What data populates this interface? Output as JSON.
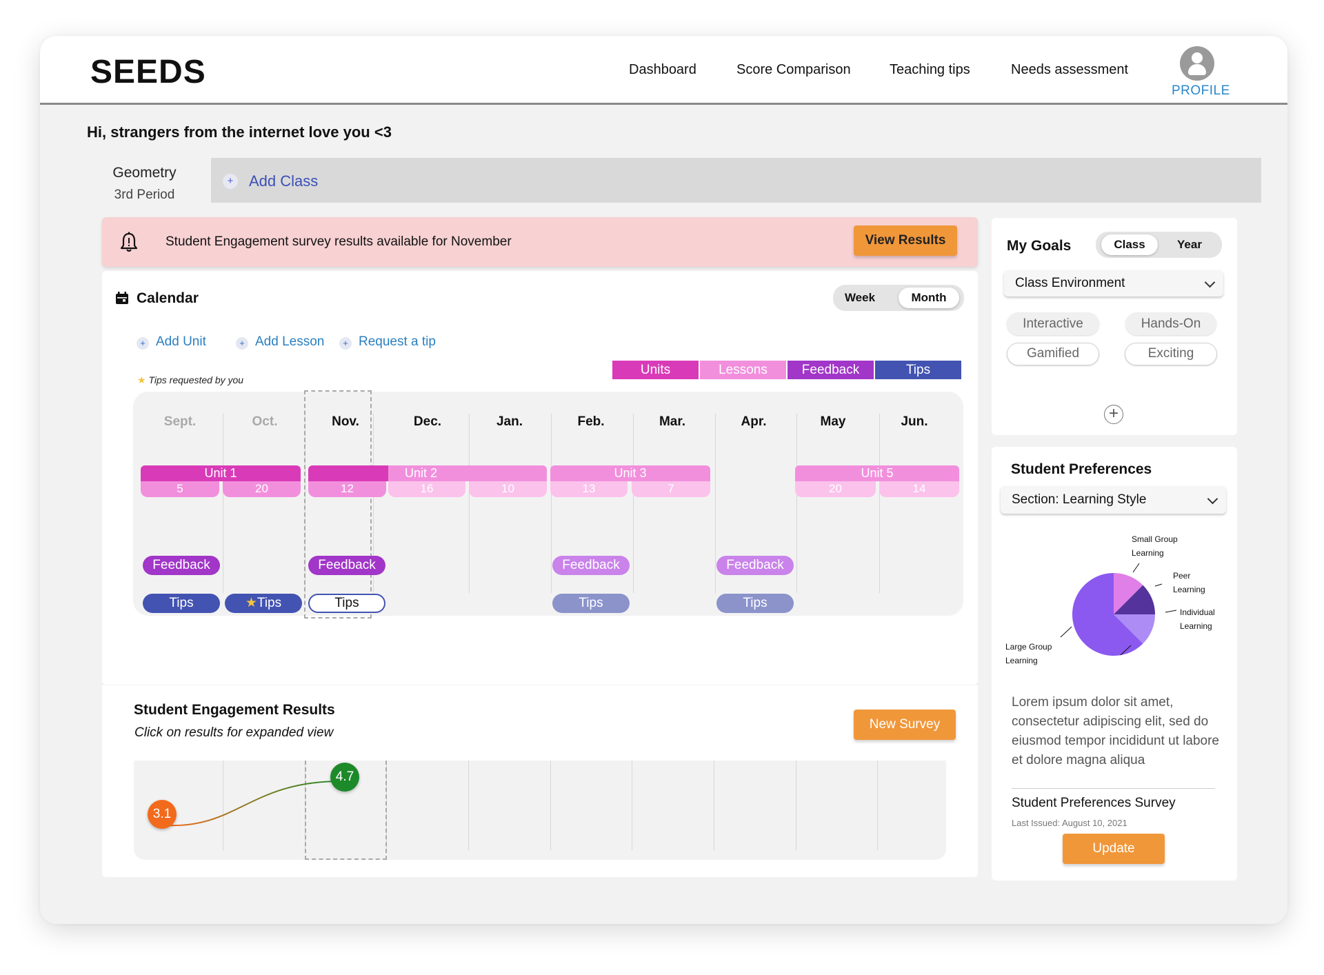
{
  "header": {
    "logo": "SEEDS",
    "nav": [
      "Dashboard",
      "Score Comparison",
      "Teaching tips",
      "Needs assessment"
    ],
    "profile_label": "PROFILE"
  },
  "greeting": "Hi, strangers from the internet love you <3",
  "class_tabs": {
    "active": {
      "name": "Geometry",
      "period": "3rd Period"
    },
    "add_class": "Add Class",
    "add_icon": "+"
  },
  "banner": {
    "text": "Student Engagement survey results available for November",
    "button": "View Results"
  },
  "calendar": {
    "title": "Calendar",
    "view_toggle": [
      "Week",
      "Month"
    ],
    "active_view": "Month",
    "actions": [
      "Add Unit",
      "Add Lesson",
      "Request a tip"
    ],
    "plus_icon": "+",
    "legend": [
      {
        "label": "Units",
        "color": "#d93bb8"
      },
      {
        "label": "Lessons",
        "color": "#f28fdd"
      },
      {
        "label": "Feedback",
        "color": "#a136c8"
      },
      {
        "label": "Tips",
        "color": "#4353b2"
      }
    ],
    "tips_note": "Tips requested by you",
    "star_icon": "★",
    "months": [
      "Sept.",
      "Oct.",
      "Nov.",
      "Dec.",
      "Jan.",
      "Feb.",
      "Mar.",
      "Apr.",
      "May",
      "Jun."
    ],
    "current_month": "Nov.",
    "units": [
      "Unit 1",
      "Unit 2",
      "Unit 3",
      "Unit 5"
    ],
    "lesson_days": [
      "5",
      "20",
      "12",
      "16",
      "10",
      "13",
      "7",
      "20",
      "14"
    ],
    "feedback_label": "Feedback",
    "tips_label": "Tips"
  },
  "engagement": {
    "title": "Student Engagement Results",
    "subtitle": "Click on results for expanded view",
    "button": "New Survey",
    "scores": [
      "3.1",
      "4.7"
    ]
  },
  "goals": {
    "title": "My Goals",
    "toggle": [
      "Class",
      "Year"
    ],
    "active_toggle": "Class",
    "dropdown": "Class Environment",
    "chips": [
      "Interactive",
      "Hands-On",
      "Gamified",
      "Exciting"
    ],
    "add_icon": "+"
  },
  "preferences": {
    "title": "Student Preferences",
    "dropdown": "Section: Learning Style",
    "pie": [
      {
        "label": "Small Group Learning",
        "line1": "Small Group",
        "line2": "Learning",
        "value": 12.5,
        "color": "#e07fe8"
      },
      {
        "label": "Peer Learning",
        "line1": "Peer",
        "line2": "Learning",
        "value": 12.5,
        "color": "#54339c"
      },
      {
        "label": "Individual Learning",
        "line1": "Individual",
        "line2": "Learning",
        "value": 12.5,
        "color": "#ad8cf5"
      },
      {
        "label": "Large Group Learning",
        "line1": "Large Group",
        "line2": "Learning",
        "value": 62.5,
        "color": "#8b59ef"
      }
    ],
    "description": "Lorem ipsum dolor sit amet, consectetur adipiscing elit, sed do eiusmod tempor incididunt ut labore et dolore magna aliqua",
    "survey_name": "Student Preferences Survey",
    "last_issued": "Last Issued: August 10, 2021",
    "update_button": "Update"
  }
}
